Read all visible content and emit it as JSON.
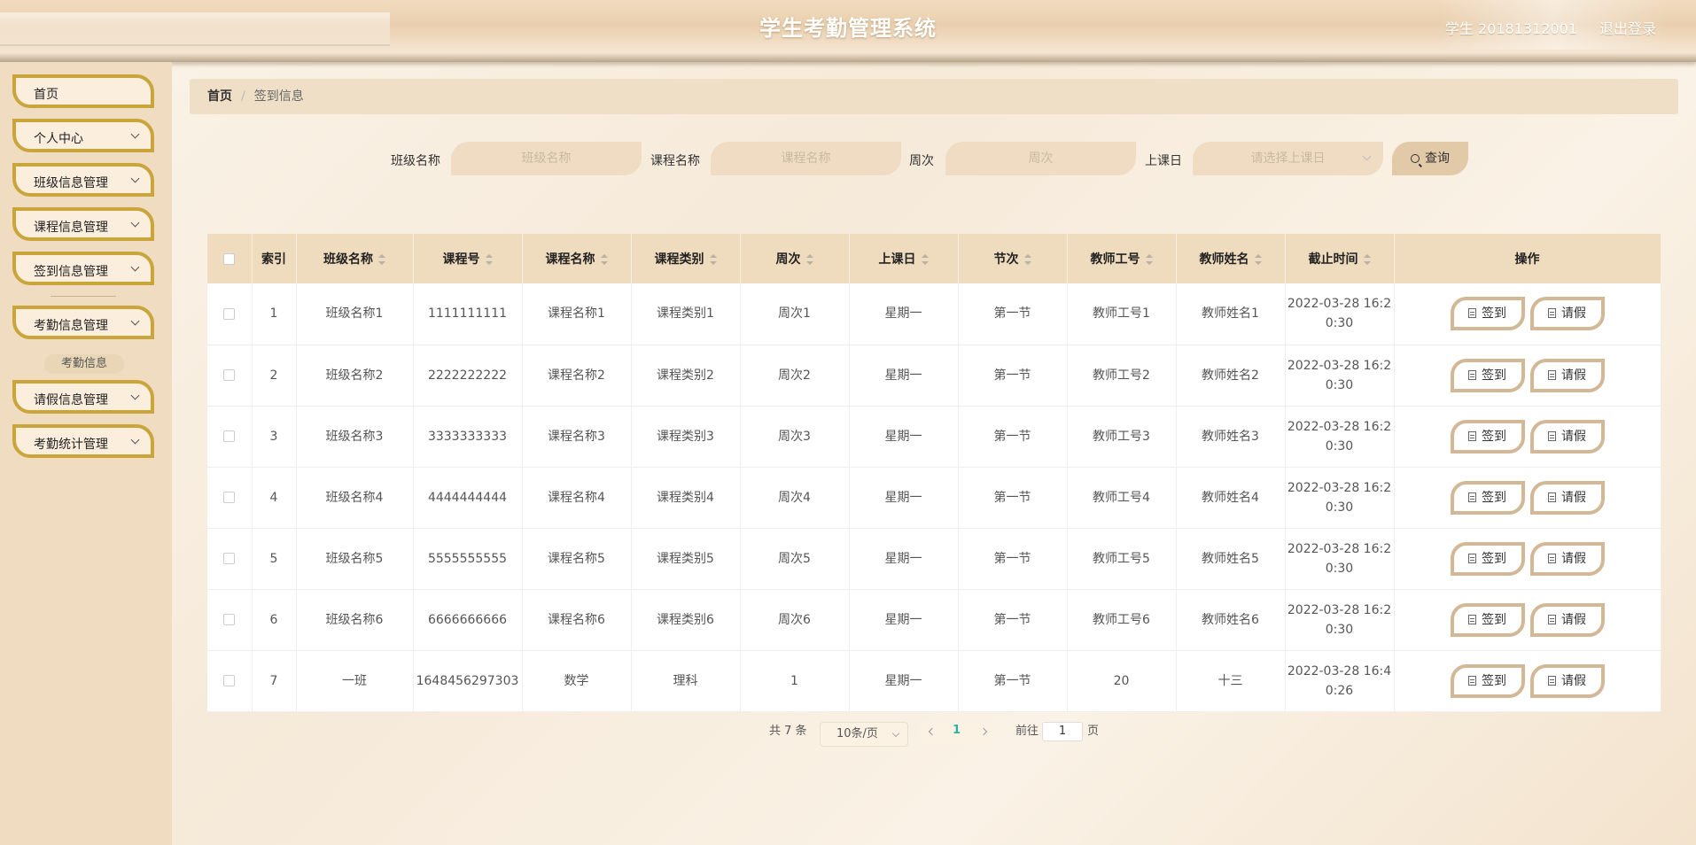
{
  "header": {
    "title": "学生考勤管理系统",
    "user": "学生 20181312001",
    "logout": "退出登录"
  },
  "sidebar": {
    "items": [
      {
        "label": "首页"
      },
      {
        "label": "个人中心"
      },
      {
        "label": "班级信息管理"
      },
      {
        "label": "课程信息管理"
      },
      {
        "label": "签到信息管理"
      },
      {
        "label": "考勤信息管理"
      },
      {
        "label": "请假信息管理"
      },
      {
        "label": "考勤统计管理"
      }
    ],
    "sub_item": "考勤信息"
  },
  "breadcrumb": {
    "home": "首页",
    "separator": "/",
    "current": "签到信息"
  },
  "search": {
    "class_label": "班级名称",
    "class_placeholder": "班级名称",
    "course_label": "课程名称",
    "course_placeholder": "课程名称",
    "week_label": "周次",
    "week_placeholder": "周次",
    "day_label": "上课日",
    "day_placeholder": "请选择上课日",
    "button": "查询"
  },
  "table": {
    "headers": [
      "索引",
      "班级名称",
      "课程号",
      "课程名称",
      "课程类别",
      "周次",
      "上课日",
      "节次",
      "教师工号",
      "教师姓名",
      "截止时间",
      "操作"
    ],
    "rows": [
      [
        "1",
        "班级名称1",
        "1111111111",
        "课程名称1",
        "课程类别1",
        "周次1",
        "星期一",
        "第一节",
        "教师工号1",
        "教师姓名1",
        "2022-03-28 16:20:30"
      ],
      [
        "2",
        "班级名称2",
        "2222222222",
        "课程名称2",
        "课程类别2",
        "周次2",
        "星期一",
        "第一节",
        "教师工号2",
        "教师姓名2",
        "2022-03-28 16:20:30"
      ],
      [
        "3",
        "班级名称3",
        "3333333333",
        "课程名称3",
        "课程类别3",
        "周次3",
        "星期一",
        "第一节",
        "教师工号3",
        "教师姓名3",
        "2022-03-28 16:20:30"
      ],
      [
        "4",
        "班级名称4",
        "4444444444",
        "课程名称4",
        "课程类别4",
        "周次4",
        "星期一",
        "第一节",
        "教师工号4",
        "教师姓名4",
        "2022-03-28 16:20:30"
      ],
      [
        "5",
        "班级名称5",
        "5555555555",
        "课程名称5",
        "课程类别5",
        "周次5",
        "星期一",
        "第一节",
        "教师工号5",
        "教师姓名5",
        "2022-03-28 16:20:30"
      ],
      [
        "6",
        "班级名称6",
        "6666666666",
        "课程名称6",
        "课程类别6",
        "周次6",
        "星期一",
        "第一节",
        "教师工号6",
        "教师姓名6",
        "2022-03-28 16:20:30"
      ],
      [
        "7",
        "一班",
        "1648456297303",
        "数学",
        "理科",
        "1",
        "星期一",
        "第一节",
        "20",
        "十三",
        "2022-03-28 16:40:26"
      ]
    ],
    "actions": {
      "sign": "签到",
      "leave": "请假"
    }
  },
  "pagination": {
    "total": "共 7 条",
    "page_size": "10条/页",
    "current_page": "1",
    "goto_label": "前往",
    "goto_value": "1",
    "page_suffix": "页"
  }
}
